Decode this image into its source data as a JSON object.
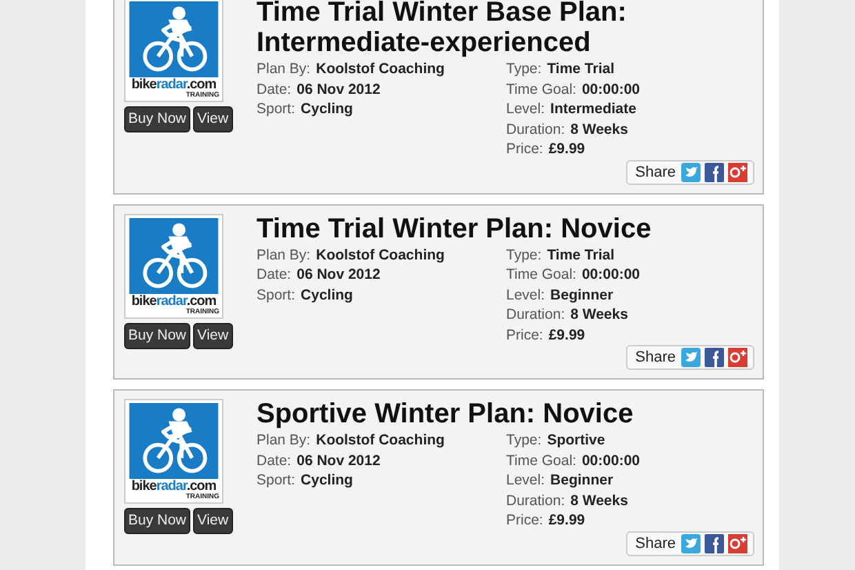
{
  "plans": [
    {
      "logo": {
        "wordmark": [
          "bike",
          "radar",
          ".com"
        ],
        "tagline": "TRAINING"
      },
      "buttons": [
        "Buy Now",
        "View"
      ],
      "title": "Time Trial Winter Base Plan: Intermediate-experienced",
      "left": [
        {
          "label": "Plan By:",
          "value": "Koolstof Coaching"
        },
        {
          "label": "Date:",
          "value": "06 Nov 2012"
        },
        {
          "label": "Sport:",
          "value": "Cycling"
        }
      ],
      "right": [
        {
          "label": "Type:",
          "value": "Time Trial"
        },
        {
          "label": "Time Goal:",
          "value": "00:00:00"
        },
        {
          "label": "Level:",
          "value": "Intermediate"
        },
        {
          "label": "Duration:",
          "value": "8 Weeks"
        },
        {
          "label": "Price:",
          "value": "£9.99"
        }
      ],
      "share": "Share"
    },
    {
      "logo": {
        "wordmark": [
          "bike",
          "radar",
          ".com"
        ],
        "tagline": "TRAINING"
      },
      "buttons": [
        "Buy Now",
        "View"
      ],
      "title": "Time Trial Winter Plan: Novice",
      "left": [
        {
          "label": "Plan By:",
          "value": "Koolstof Coaching"
        },
        {
          "label": "Date:",
          "value": "06 Nov 2012"
        },
        {
          "label": "Sport:",
          "value": "Cycling"
        }
      ],
      "right": [
        {
          "label": "Type:",
          "value": "Time Trial"
        },
        {
          "label": "Time Goal:",
          "value": "00:00:00"
        },
        {
          "label": "Level:",
          "value": "Beginner"
        },
        {
          "label": "Duration:",
          "value": "8 Weeks"
        },
        {
          "label": "Price:",
          "value": "£9.99"
        }
      ],
      "share": "Share"
    },
    {
      "logo": {
        "wordmark": [
          "bike",
          "radar",
          ".com"
        ],
        "tagline": "TRAINING"
      },
      "buttons": [
        "Buy Now",
        "View"
      ],
      "title": "Sportive Winter Plan: Novice",
      "left": [
        {
          "label": "Plan By:",
          "value": "Koolstof Coaching"
        },
        {
          "label": "Date:",
          "value": "06 Nov 2012"
        },
        {
          "label": "Sport:",
          "value": "Cycling"
        }
      ],
      "right": [
        {
          "label": "Type:",
          "value": "Sportive"
        },
        {
          "label": "Time Goal:",
          "value": "00:00:00"
        },
        {
          "label": "Level:",
          "value": "Beginner"
        },
        {
          "label": "Duration:",
          "value": "8 Weeks"
        },
        {
          "label": "Price:",
          "value": "£9.99"
        }
      ],
      "share": "Share"
    }
  ]
}
